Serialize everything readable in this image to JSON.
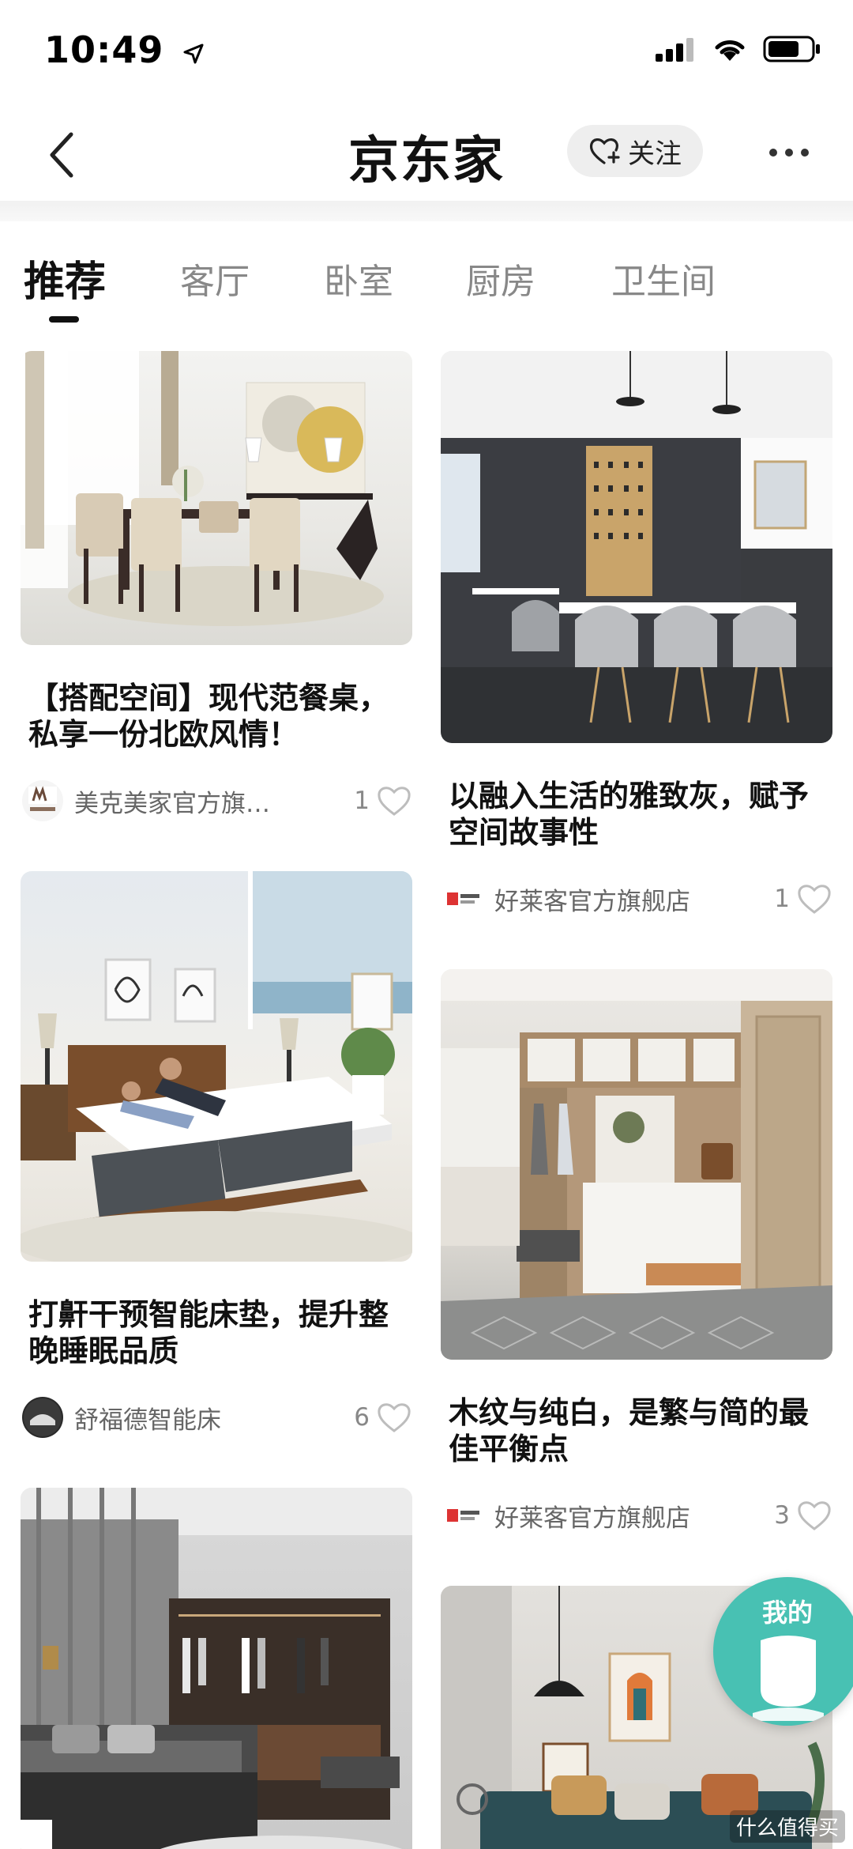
{
  "status_bar": {
    "time": "10:49"
  },
  "nav": {
    "title": "京东家",
    "follow_label": "关注"
  },
  "tabs": [
    {
      "label": "推荐"
    },
    {
      "label": "客厅"
    },
    {
      "label": "卧室"
    },
    {
      "label": "厨房"
    },
    {
      "label": "卫生间"
    }
  ],
  "feed": {
    "left": [
      {
        "title": "【搭配空间】现代范餐桌，私享一份北欧风情！",
        "shop": "美克美家官方旗…",
        "likes": "1"
      },
      {
        "title": "打鼾干预智能床垫，提升整晚睡眠品质",
        "shop": "舒福德智能床",
        "likes": "6"
      }
    ],
    "right": [
      {
        "title": "以融入生活的雅致灰，赋予空间故事性",
        "shop": "好莱客官方旗舰店",
        "likes": "1"
      },
      {
        "title": "木纹与纯白，是繁与简的最佳平衡点",
        "shop": "好莱客官方旗舰店",
        "likes": "3"
      }
    ]
  },
  "fab": {
    "label": "我的"
  },
  "watermark": "什么值得买",
  "colors": {
    "accent": "#48c1b3",
    "text": "#111111",
    "muted": "#888888"
  }
}
